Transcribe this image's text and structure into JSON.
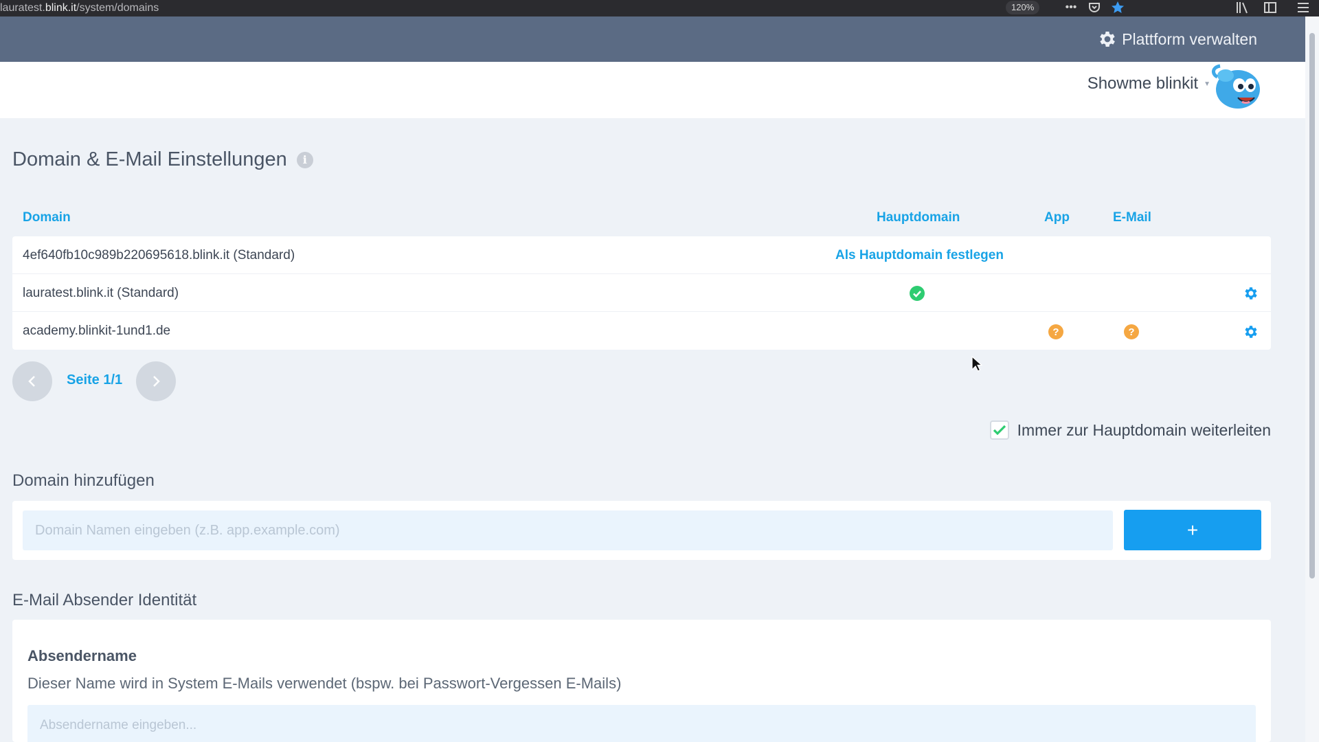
{
  "browser": {
    "url_prefix": "lauratest.",
    "url_host": "blink.it",
    "url_path": "/system/domains",
    "zoom": "120%",
    "more_icon": "more-icon",
    "pocket_icon": "pocket-icon",
    "bookmark_icon": "star-icon",
    "library_icon": "library-icon",
    "sidebar_icon": "sidebar-icon",
    "menu_icon": "hamburger-menu-icon"
  },
  "topnav": {
    "platform_label": "Plattform verwalten",
    "platform_icon": "gear-icon"
  },
  "user": {
    "name": "Showme blinkit",
    "avatar_icon": "blue-fish-mascot-icon"
  },
  "page": {
    "title": "Domain & E-Mail Einstellungen",
    "info_icon": "info-icon"
  },
  "table": {
    "headers": {
      "domain": "Domain",
      "main": "Hauptdomain",
      "app": "App",
      "email": "E-Mail"
    },
    "rows": [
      {
        "domain": "4ef640fb10c989b220695618.blink.it (Standard)",
        "main_action": "Als Hauptdomain festlegen",
        "main_status": "",
        "app_status": "",
        "email_status": "",
        "settings": false
      },
      {
        "domain": "lauratest.blink.it (Standard)",
        "main_action": "",
        "main_status": "check",
        "app_status": "",
        "email_status": "",
        "settings": true
      },
      {
        "domain": "academy.blinkit-1und1.de",
        "main_action": "",
        "main_status": "",
        "app_status": "question",
        "email_status": "question",
        "settings": true
      }
    ]
  },
  "pagination": {
    "label": "Seite 1/1",
    "prev_icon": "chevron-left-icon",
    "next_icon": "chevron-right-icon"
  },
  "redirect": {
    "label": "Immer zur Hauptdomain weiterleiten",
    "checked": true
  },
  "add_domain": {
    "heading": "Domain hinzufügen",
    "placeholder": "Domain Namen eingeben (z.B. app.example.com)",
    "value": "",
    "button_label": "+"
  },
  "sender": {
    "heading": "E-Mail Absender Identität",
    "label": "Absendername",
    "description": "Dieser Name wird in System E-Mails verwendet (bspw. bei Passwort-Vergessen E-Mails)",
    "placeholder": "Absendername eingeben...",
    "value": ""
  },
  "colors": {
    "accent": "#18a3e6",
    "nav": "#5b6b84",
    "success": "#2ecc71",
    "warning": "#f5a742",
    "background": "#eef2f7"
  }
}
